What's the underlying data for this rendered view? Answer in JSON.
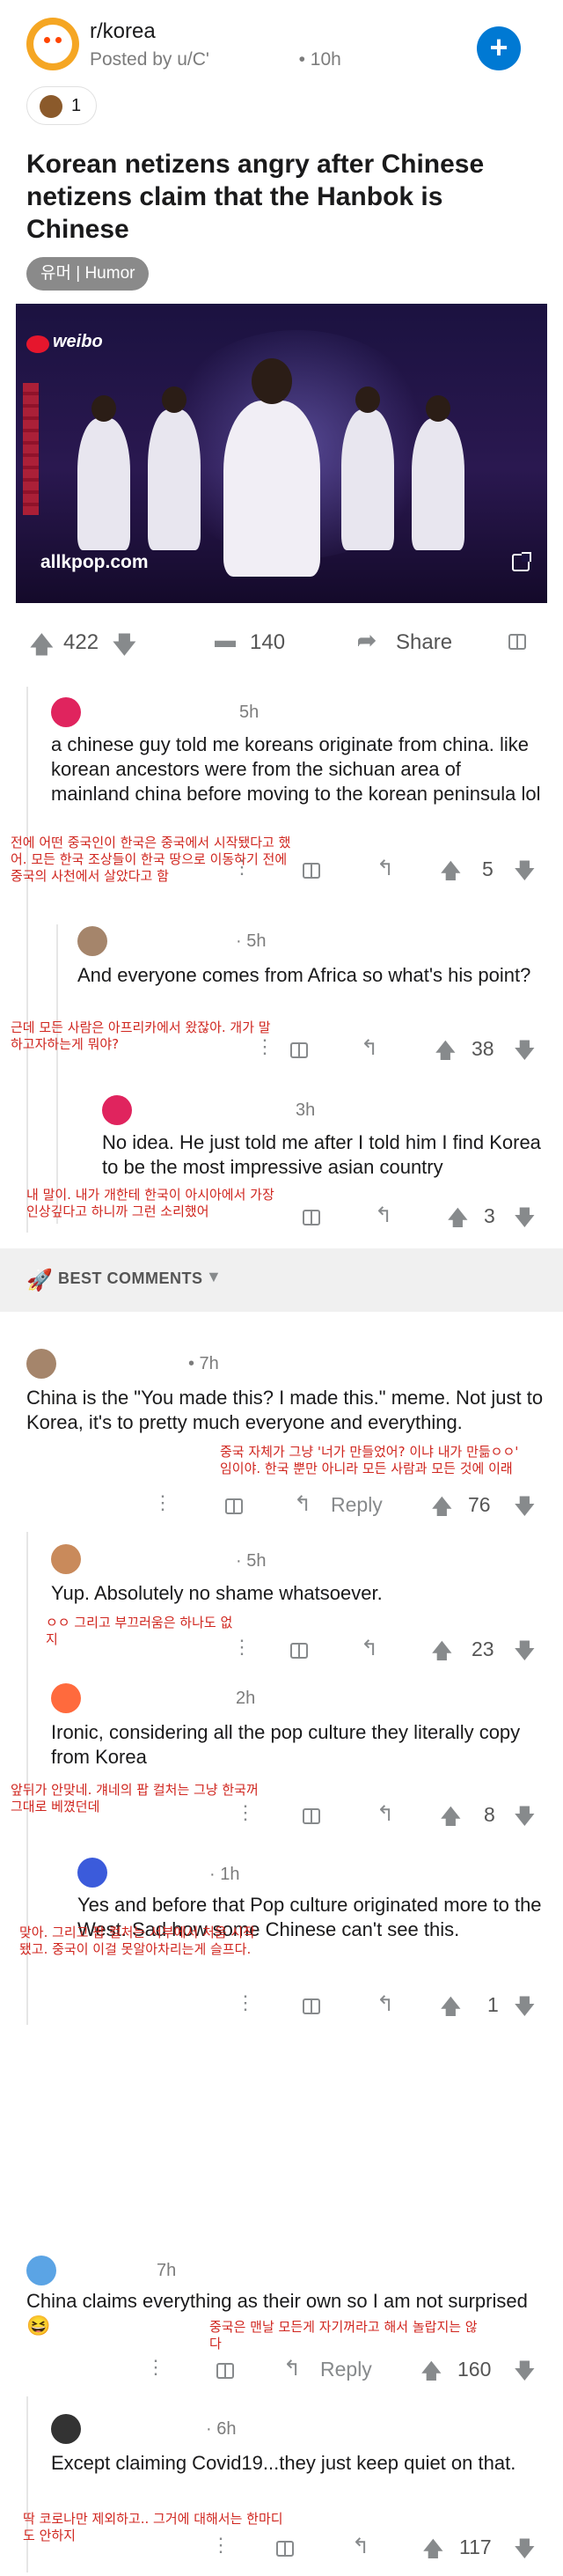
{
  "post": {
    "subreddit": "r/korea",
    "posted_by": "Posted by u/C'",
    "posted_time": "• 10h",
    "award_count": "1",
    "title": "Korean netizens angry after Chinese netizens claim that the Hanbok is Chinese",
    "flair": "유머 | Humor",
    "video_source": "allkpop.com",
    "video_watermark": "weibo",
    "upvotes": "422",
    "comments": "140",
    "share_label": "Share"
  },
  "thread": [
    {
      "time": "5h",
      "text": "a chinese guy told me koreans originate from china. like korean ancestors were from the sichuan area of mainland china before moving to the korean peninsula lol",
      "translation": "전에 어떤 중국인이 한국은 중국에서 시작됐다고 했어. 모든 한국 조상들이 한국 땅으로 이동하기 전에 중국의 사천에서 살았다고 함",
      "votes": "5"
    },
    {
      "time": "· 5h",
      "text": "And everyone comes from Africa so what's his point?",
      "translation": "근데 모든 사람은 아프리카에서 왔잖아. 개가 말하고자하는게 뭐야?",
      "votes": "38"
    },
    {
      "time": "3h",
      "text": "No idea. He just told me after I told him I find Korea to be the most impressive asian country",
      "translation": "내 말이. 내가 개한테 한국이 아시아에서 가장 인상깊다고 하니까 그런 소리했어",
      "votes": "3"
    }
  ],
  "best_comments_label": "BEST COMMENTS",
  "best": [
    {
      "time": "• 7h",
      "text": "China is the \"You made this? I made this.\" meme. Not just to Korea, it's to pretty much everyone and everything.",
      "translation": "중국 자체가 그냥 '너가 만들었어? 이냐 내가 만듦ㅇㅇ' 임이야. 한국 뿐만 아니라 모든 사람과 모든 것에 이래",
      "reply_label": "Reply",
      "votes": "76"
    },
    {
      "time": "· 5h",
      "text": "Yup. Absolutely no shame whatsoever.",
      "translation": "ㅇㅇ 그리고 부끄러움은 하나도 없지",
      "votes": "23"
    },
    {
      "time": "2h",
      "text": "Ironic, considering all the pop culture they literally copy from Korea",
      "translation": "앞뒤가 안맞네. 걔네의 팝 컬처는 그냥 한국꺼 그대로 베꼈던데",
      "votes": "8"
    },
    {
      "time": "· 1h",
      "text": "Yes and before that Pop culture originated more to the West. Sad how some Chinese can't see this.",
      "translation": "맞아. 그리고 팝 컬처는 서부에서 처음 시작됐고. 중국이 이걸 못알아차리는게 슬프다.",
      "votes": "1"
    },
    {
      "time": "7h",
      "text": "China claims everything as their own so I am not surprised 😆",
      "translation": "중국은 맨날 모든게 자기꺼라고 해서 놀랍지는 않다",
      "reply_label": "Reply",
      "votes": "160"
    },
    {
      "time": "· 6h",
      "text": "Except claiming Covid19...they just keep quiet on that.",
      "translation": "딱 코로나만 제외하고.. 그거에 대해서는 한마디도 안하지",
      "votes": "117"
    }
  ]
}
